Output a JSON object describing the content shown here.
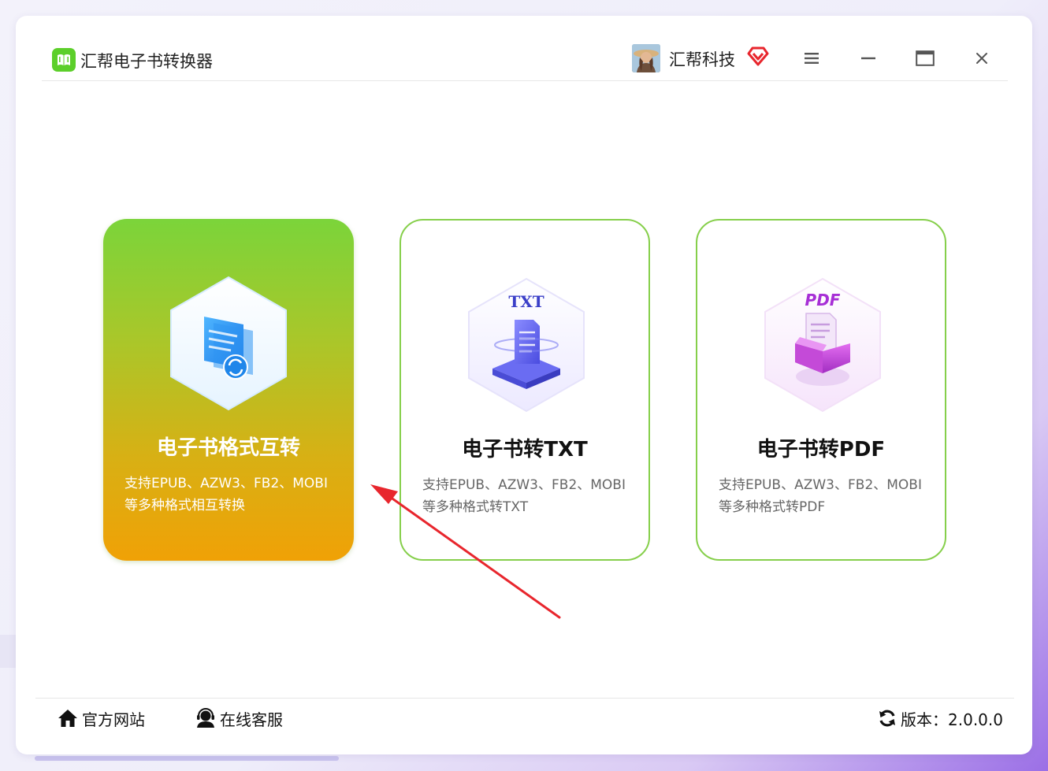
{
  "app": {
    "title": "汇帮电子书转换器",
    "logo_icon": "book-icon",
    "accent_color": "#5ccf2a"
  },
  "user": {
    "name": "汇帮科技",
    "avatar_icon": "user-avatar",
    "vip_icon": "vip-heart-icon",
    "vip_color": "#e8262d"
  },
  "window_controls": [
    "menu-icon",
    "minimize-icon",
    "maximize-icon",
    "close-icon"
  ],
  "cards": [
    {
      "title": "电子书格式互转",
      "desc_line1": "支持EPUB、AZW3、FB2、MOBI",
      "desc_line2": "等多种格式相互转换",
      "icon": "ebook-convert-icon",
      "selected": true
    },
    {
      "title": "电子书转TXT",
      "desc_line1": "支持EPUB、AZW3、FB2、MOBI",
      "desc_line2": "等多种格式转TXT",
      "icon": "txt-icon",
      "icon_label": "TXT",
      "selected": false
    },
    {
      "title": "电子书转PDF",
      "desc_line1": "支持EPUB、AZW3、FB2、MOBI",
      "desc_line2": "等多种格式转PDF",
      "icon": "pdf-icon",
      "icon_label": "PDF",
      "selected": false
    }
  ],
  "footer": {
    "website_label": "官方网站",
    "service_label": "在线客服",
    "version_label": "版本：2.0.0.0"
  },
  "annotation": {
    "arrow_color": "#e8262d"
  }
}
